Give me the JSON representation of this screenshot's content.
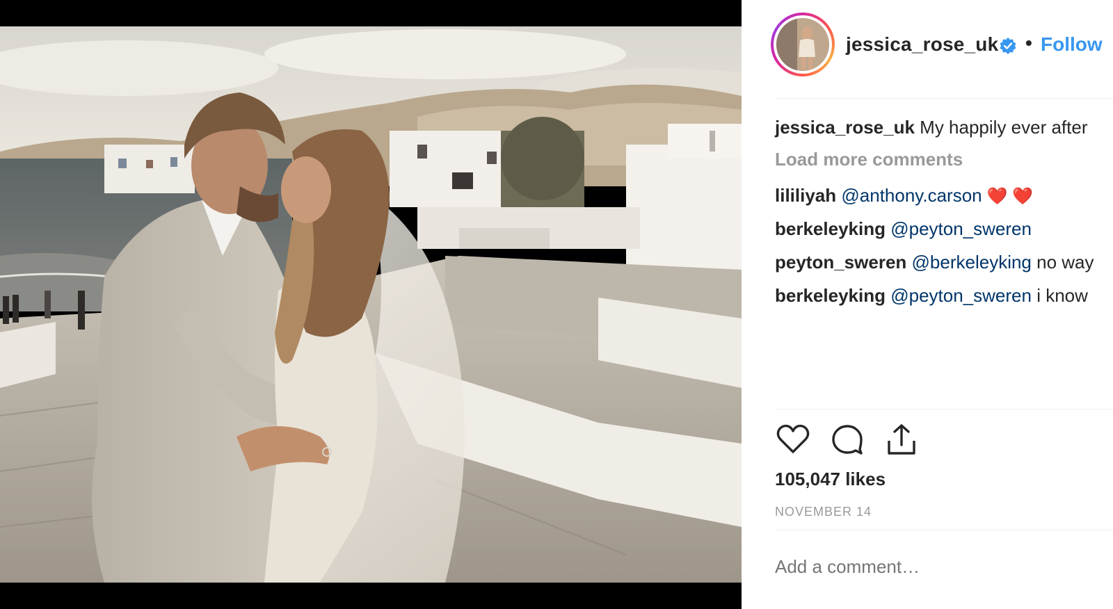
{
  "post": {
    "username": "jessica_rose_uk",
    "verified_icon": "verified-badge-icon",
    "separator": "•",
    "follow_label": "Follow"
  },
  "comments": {
    "caption": {
      "user": "jessica_rose_uk",
      "text": "My happily ever after"
    },
    "load_more": "Load more comments",
    "items": [
      {
        "user": "lililiyah",
        "mention": "@anthony.carson",
        "text": "",
        "emoji": "❤️ ❤️"
      },
      {
        "user": "berkeleyking",
        "mention": "@peyton_sweren",
        "text": "",
        "emoji": ""
      },
      {
        "user": "peyton_sweren",
        "mention": "@berkeleyking",
        "text": "no way",
        "emoji": ""
      },
      {
        "user": "berkeleyking",
        "mention": "@peyton_sweren",
        "text": "i know",
        "emoji": ""
      }
    ]
  },
  "actions": {
    "like_icon": "heart-icon",
    "comment_icon": "comment-bubble-icon",
    "share_icon": "share-icon"
  },
  "likes": "105,047 likes",
  "date": "NOVEMBER 14",
  "add_comment": {
    "placeholder": "Add a comment…"
  },
  "colors": {
    "follow_blue": "#3897f0",
    "mention_blue": "#003569",
    "muted_gray": "#999999",
    "text_dark": "#262626"
  }
}
